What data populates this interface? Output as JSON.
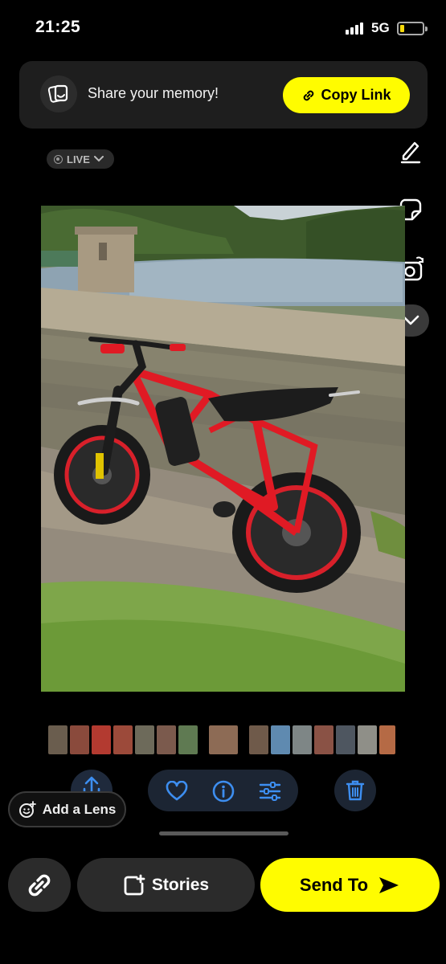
{
  "status_bar": {
    "time": "21:25",
    "network": "5G",
    "battery_level": 0.15,
    "signal_icon": "cellular-signal-icon",
    "battery_icon": "battery-icon"
  },
  "banner": {
    "text": "Share your memory!",
    "button_label": "Copy Link",
    "icon": "memory-card-icon",
    "button_icon": "link-icon"
  },
  "live_badge": {
    "label": "LIVE",
    "icon": "live-dot-icon",
    "chevron": "chevron-down-icon"
  },
  "right_tools": [
    "pencil-icon",
    "sticker-icon",
    "camera-rotate-icon",
    "chevron-down-icon"
  ],
  "photo": {
    "description_icon": "photo-bike-by-reservoir"
  },
  "action_row": {
    "icons": [
      "share-icon",
      "heart-icon",
      "info-icon",
      "sliders-icon",
      "trash-icon"
    ]
  },
  "lens_button": {
    "label": "Add a Lens",
    "icon": "smiley-plus-icon"
  },
  "bottom_bar": {
    "stories_label": "Stories",
    "send_label": "Send To",
    "link_icon": "link-icon",
    "stories_icon": "story-add-icon",
    "send_icon": "send-arrow-icon"
  },
  "colors": {
    "accent": "#fffc00",
    "background": "#000000",
    "action_icon": "#3d8ef0",
    "trash_icon": "#3d8ef0"
  }
}
